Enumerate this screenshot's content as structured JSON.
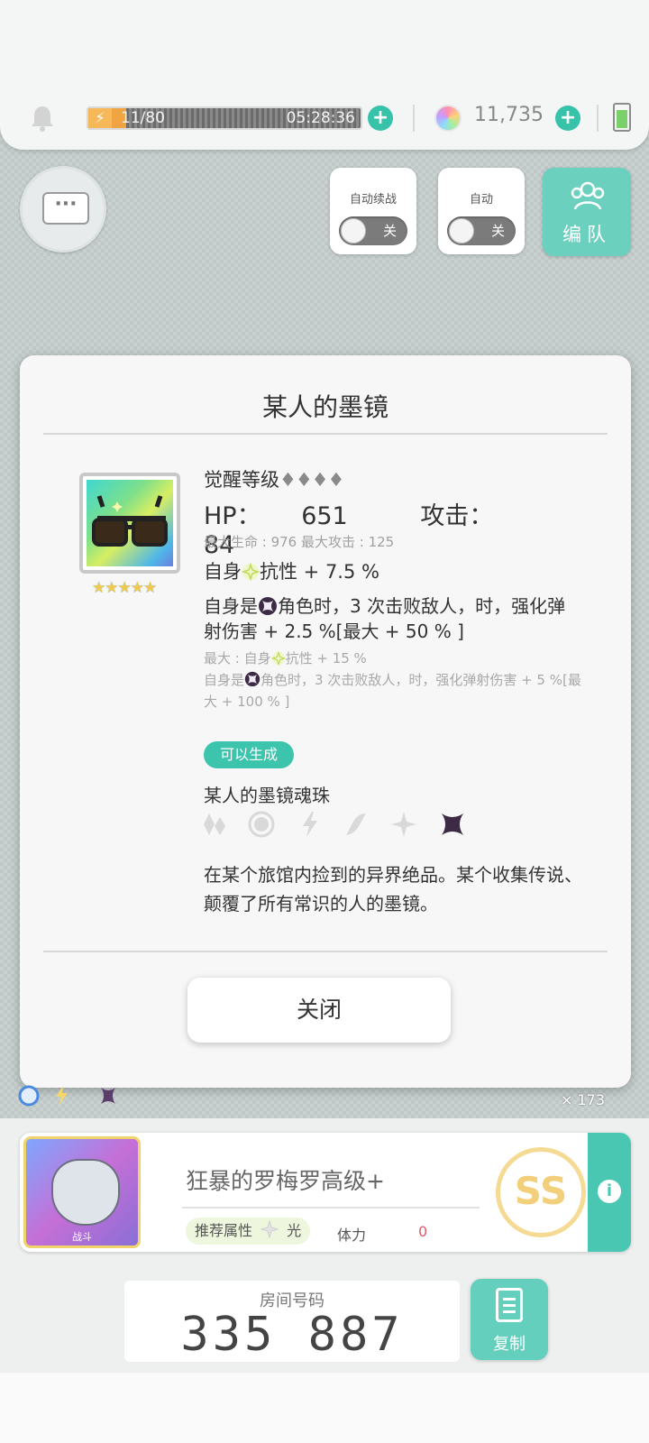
{
  "status": {
    "energy_text": "11/80",
    "energy_fraction": 0.1375,
    "energy_timer": "05:28:36",
    "gem_count": "11,735"
  },
  "battle_controls": {
    "auto_continue_label": "自动续战",
    "auto_continue_state": "关",
    "auto_label": "自动",
    "auto_state": "关",
    "team_label": "编队"
  },
  "modal": {
    "title": "某人的墨镜",
    "rarity_stars": "★★★★★",
    "awakening_label": "觉醒等级",
    "awakening_diamonds": "♦♦♦♦",
    "hp_label": "HP：",
    "hp_value": "651",
    "atk_label": "攻击：",
    "atk_value": "84",
    "max_stats": "最大生命 : 976   最大攻击 : 125",
    "effect1_prefix": "自身",
    "effect1_suffix": "抗性 + 7.5 %",
    "effect2_prefix": "自身是",
    "effect2_suffix": "角色时，3 次击败敌人，时，强化弹射伤害 + 2.5 %[最大 + 50 % ]",
    "max_effect1_prefix": "最大 : 自身",
    "max_effect1_suffix": "抗性 + 15 %",
    "max_effect2_prefix": "自身是",
    "max_effect2_suffix": "角色时，3 次击败敌人，时，强化弹射伤害 + 5 %[最大 + 100 % ]",
    "can_generate": "可以生成",
    "soul_orb_name": "某人的墨镜魂珠",
    "description": "在某个旅馆内捡到的异界绝品。某个收集传说、颠覆了所有常识的人的墨镜。",
    "close_label": "关闭"
  },
  "background": {
    "item_count": "× 173"
  },
  "quest": {
    "boss_tag": "战斗",
    "title": "狂暴的罗梅罗高级+",
    "recommended_label": "推荐属性",
    "recommended_element": "光",
    "stamina_label": "体力",
    "stamina_value": "0",
    "rank": "SS"
  },
  "room": {
    "label": "房间号码",
    "number": "335 887",
    "copy_label": "复制"
  },
  "colors": {
    "accent": "#3cc4ad",
    "energy": "#f0a542",
    "stamina_value": "#e05a6a"
  },
  "icons": {
    "attributes": [
      "fire-icon",
      "water-icon",
      "thunder-icon",
      "wind-icon",
      "light-icon",
      "dark-icon"
    ]
  }
}
